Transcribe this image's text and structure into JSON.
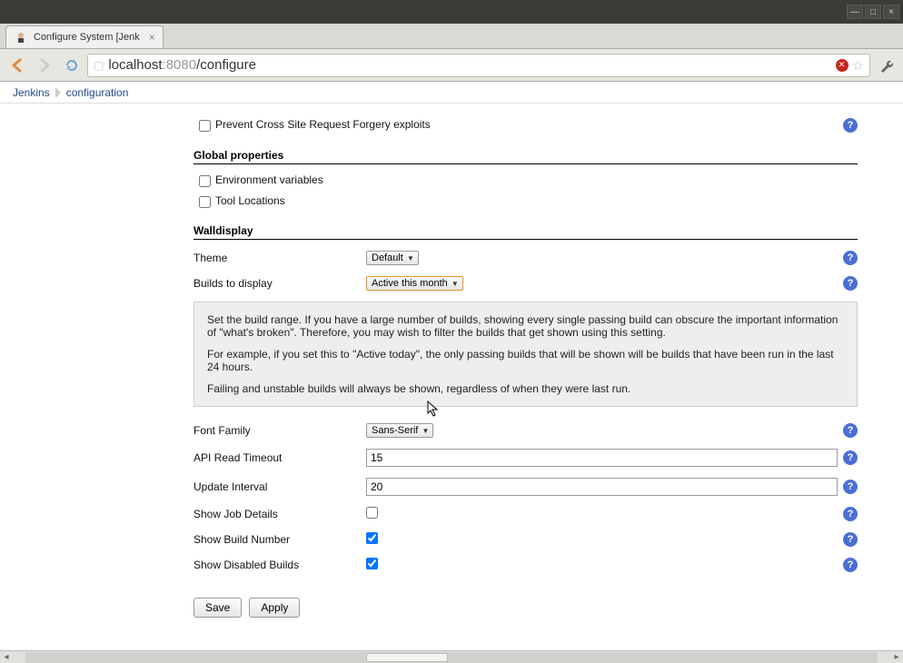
{
  "window": {
    "title": "Configure System [Jenk"
  },
  "nav": {
    "url_host": "localhost",
    "url_port": ":8080",
    "url_path": "/configure"
  },
  "breadcrumbs": [
    "Jenkins",
    "configuration"
  ],
  "csrf": {
    "label": "Prevent Cross Site Request Forgery exploits",
    "checked": false
  },
  "global_properties": {
    "header": "Global properties",
    "env_vars": {
      "label": "Environment variables",
      "checked": false
    },
    "tool_locations": {
      "label": "Tool Locations",
      "checked": false
    }
  },
  "walldisplay": {
    "header": "Walldisplay",
    "theme": {
      "label": "Theme",
      "value": "Default"
    },
    "builds_to_display": {
      "label": "Builds to display",
      "value": "Active this month"
    },
    "help": {
      "p1": "Set the build range. If you have a large number of builds, showing every single passing build can obscure the important information of \"what's broken\". Therefore, you may wish to filter the builds that get shown using this setting.",
      "p2": "For example, if you set this to \"Active today\", the only passing builds that will be shown will be builds that have been run in the last 24 hours.",
      "p3": "Failing and unstable builds will always be shown, regardless of when they were last run."
    },
    "font_family": {
      "label": "Font Family",
      "value": "Sans-Serif"
    },
    "api_read_timeout": {
      "label": "API Read Timeout",
      "value": "15"
    },
    "update_interval": {
      "label": "Update Interval",
      "value": "20"
    },
    "show_job_details": {
      "label": "Show Job Details",
      "checked": false
    },
    "show_build_number": {
      "label": "Show Build Number",
      "checked": true
    },
    "show_disabled_builds": {
      "label": "Show Disabled Builds",
      "checked": true
    }
  },
  "buttons": {
    "save": "Save",
    "apply": "Apply"
  }
}
